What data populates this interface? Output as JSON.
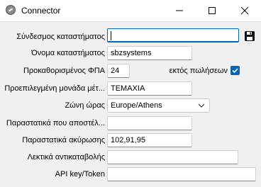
{
  "window": {
    "title": "Connector"
  },
  "form": {
    "store_link": {
      "label": "Σύνδεσμος καταστήματος",
      "value": ""
    },
    "store_name": {
      "label": "Όνομα καταστήματος",
      "value": "sbzsystems"
    },
    "default_vat": {
      "label": "Προκαθορισμένος ΦΠΑ",
      "value": "24"
    },
    "exempt_sales": {
      "label": "εκτός πωλήσεων",
      "checked": true
    },
    "default_unit": {
      "label": "Προεπιλεγμένη μονάδα μέτ...",
      "value": "ΤΕΜΑΧΙΑ"
    },
    "timezone": {
      "label": "Ζώνη ώρας",
      "value": "Europe/Athens"
    },
    "sent_documents": {
      "label": "Παραστατικά που αποστέλ...",
      "value": ""
    },
    "cancel_documents": {
      "label": "Παραστατικά ακύρωσης",
      "value": "102,91,95"
    },
    "cancel_words": {
      "label": "Λεκτικά αντικαταβολής",
      "value": ""
    },
    "api_key": {
      "label": "API key/Token",
      "value": ""
    }
  },
  "icons": {
    "app": "connector-app-icon",
    "save": "floppy-disk-icon",
    "minimize": "minimize-icon",
    "maximize": "maximize-icon",
    "close": "close-icon",
    "dropdown": "chevron-down-icon",
    "check": "checkmark-icon"
  },
  "colors": {
    "accent": "#0067c0",
    "background": "#f0f0f0"
  }
}
